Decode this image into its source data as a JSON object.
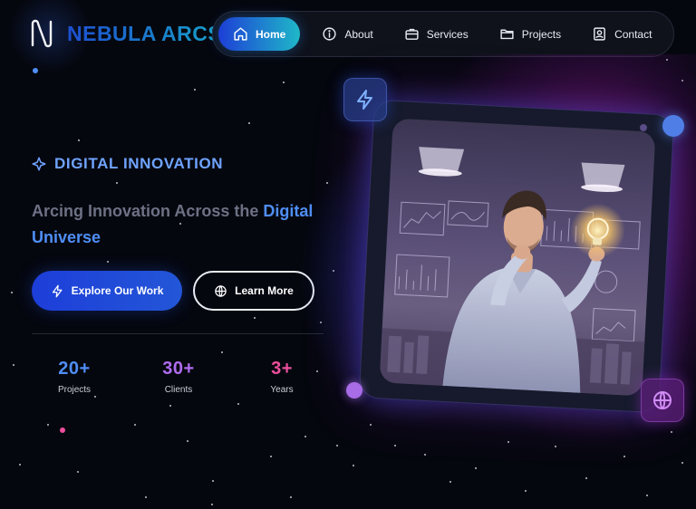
{
  "brand": {
    "name": "NEBULA ARCS",
    "logo_icon": "logo-n-icon"
  },
  "nav": {
    "items": [
      {
        "label": "Home",
        "icon": "home-icon",
        "active": true
      },
      {
        "label": "About",
        "icon": "info-icon",
        "active": false
      },
      {
        "label": "Services",
        "icon": "briefcase-icon",
        "active": false
      },
      {
        "label": "Projects",
        "icon": "folder-icon",
        "active": false
      },
      {
        "label": "Contact",
        "icon": "contact-icon",
        "active": false
      }
    ]
  },
  "hero": {
    "tagline": "DIGITAL INNOVATION",
    "tagline_icon": "sparkle-icon",
    "headline_prefix": "Arcing Innovation Across the ",
    "headline_highlight": "Digital Universe",
    "primary_button": {
      "label": "Explore Our Work",
      "icon": "bolt-icon"
    },
    "secondary_button": {
      "label": "Learn More",
      "icon": "globe-icon"
    }
  },
  "stats": [
    {
      "value": "20+",
      "label": "Projects",
      "color": "#4f8ef5"
    },
    {
      "value": "30+",
      "label": "Clients",
      "color": "#b06cf0"
    },
    {
      "value": "3+",
      "label": "Years",
      "color": "#ec4f9c"
    }
  ],
  "visual": {
    "top_badge_icon": "bolt-icon",
    "bottom_badge_icon": "globe-icon"
  },
  "colors": {
    "background": "#05070f",
    "accent_blue": "#4f8ef5",
    "accent_purple": "#b06cf0",
    "accent_pink": "#ec4f9c",
    "nav_active_start": "#1d3fd6",
    "nav_active_end": "#1fb8c8"
  }
}
